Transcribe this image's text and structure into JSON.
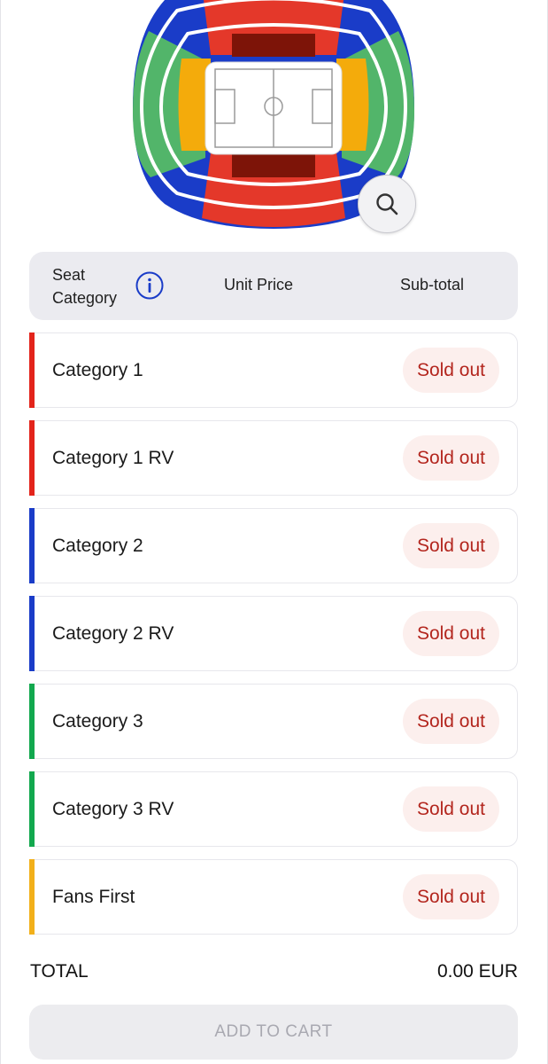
{
  "colors": {
    "category_1": "#e3241b",
    "category_2": "#1a3cc8",
    "category_3": "#12a84e",
    "fans_first": "#f2b01a",
    "sold_out_text": "#b3261e",
    "sold_out_bg": "#fcefed"
  },
  "map": {
    "zoom_icon": "search-icon"
  },
  "table_header": {
    "seat_category": "Seat\nCategory",
    "info_icon": "info-icon",
    "unit_price": "Unit Price",
    "subtotal": "Sub-total"
  },
  "rows": [
    {
      "name": "Category 1",
      "status": "Sold out",
      "color": "#e3241b"
    },
    {
      "name": "Category 1 RV",
      "status": "Sold out",
      "color": "#e3241b"
    },
    {
      "name": "Category 2",
      "status": "Sold out",
      "color": "#1a3cc8"
    },
    {
      "name": "Category 2 RV",
      "status": "Sold out",
      "color": "#1a3cc8"
    },
    {
      "name": "Category 3",
      "status": "Sold out",
      "color": "#12a84e"
    },
    {
      "name": "Category 3 RV",
      "status": "Sold out",
      "color": "#12a84e"
    },
    {
      "name": "Fans First",
      "status": "Sold out",
      "color": "#f2b01a"
    }
  ],
  "total": {
    "label": "TOTAL",
    "value": "0.00 EUR"
  },
  "cart_button": {
    "label": "ADD TO CART"
  }
}
